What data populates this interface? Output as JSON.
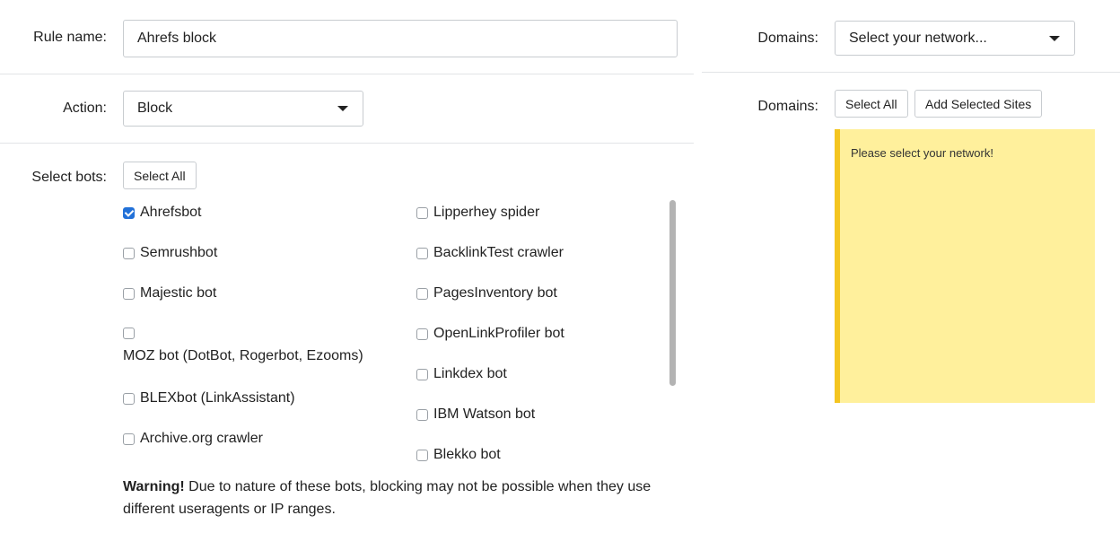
{
  "rule_name": {
    "label": "Rule name:",
    "value": "Ahrefs block"
  },
  "action": {
    "label": "Action:",
    "selected": "Block"
  },
  "bots": {
    "label": "Select bots:",
    "select_all": "Select All",
    "col1": [
      {
        "label": "Ahrefsbot",
        "checked": true
      },
      {
        "label": "Semrushbot",
        "checked": false
      },
      {
        "label": "Majestic bot",
        "checked": false
      },
      {
        "label": "MOZ bot (DotBot, Rogerbot, Ezooms)",
        "checked": false
      },
      {
        "label": "BLEXbot (LinkAssistant)",
        "checked": false
      },
      {
        "label": "Archive.org crawler",
        "checked": false
      }
    ],
    "col2": [
      {
        "label": "Lipperhey spider",
        "checked": false
      },
      {
        "label": "BacklinkTest crawler",
        "checked": false
      },
      {
        "label": "PagesInventory bot",
        "checked": false
      },
      {
        "label": "OpenLinkProfiler bot",
        "checked": false
      },
      {
        "label": "Linkdex bot",
        "checked": false
      },
      {
        "label": "IBM Watson bot",
        "checked": false
      },
      {
        "label": "Blekko bot",
        "checked": false
      }
    ],
    "warning_bold": "Warning!",
    "warning_line1": " Due to nature of these bots, blocking may not be possible when they use",
    "warning_line2": "different useragents or IP ranges."
  },
  "domains_network": {
    "label": "Domains:",
    "placeholder": "Select your network..."
  },
  "domains_sites": {
    "label": "Domains:",
    "select_all": "Select All",
    "add_selected": "Add Selected Sites",
    "notice": "Please select your network!"
  },
  "colors": {
    "notice_bg": "#fff09c",
    "notice_border": "#f4c520",
    "checkbox_checked": "#2271d8"
  }
}
